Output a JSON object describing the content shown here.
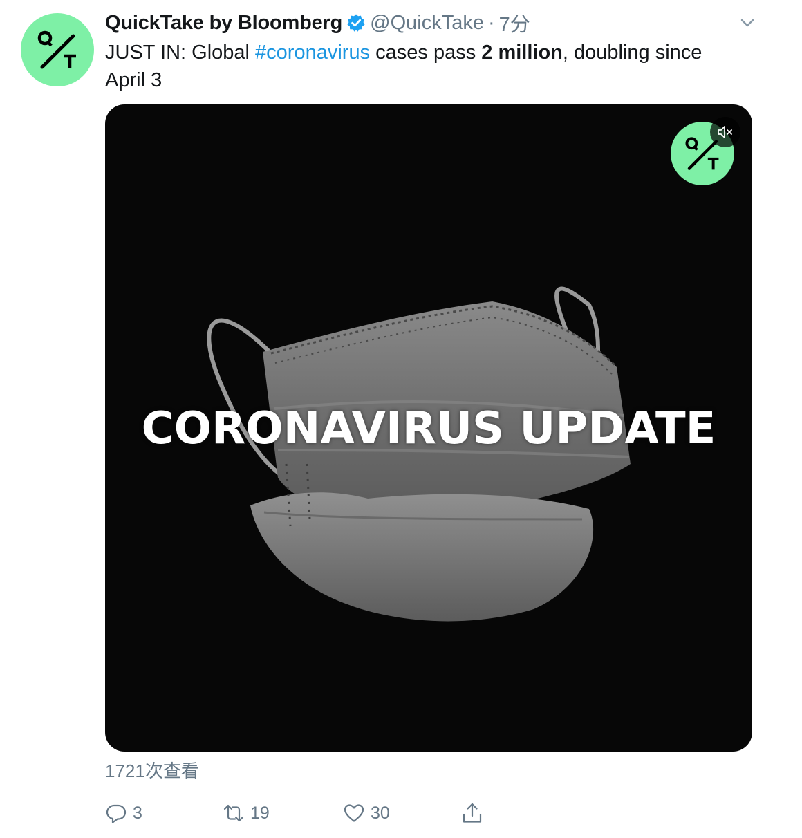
{
  "author": {
    "display_name": "QuickTake by Bloomberg",
    "handle": "@QuickTake",
    "separator": "·",
    "time": "7分",
    "avatar_icon": "quicktake-logo-icon",
    "verified_icon": "verified-badge-icon"
  },
  "tweet": {
    "text_prefix": "JUST IN: Global ",
    "hashtag": "#coronavirus",
    "text_mid": " cases pass ",
    "text_bold": "2 million",
    "text_suffix": ", doubling since April 3"
  },
  "media": {
    "video_title": "CORONAVIRUS UPDATE",
    "overlay_logo_icon": "quicktake-logo-icon",
    "mute_icon": "speaker-muted-icon"
  },
  "views": "1721次查看",
  "actions": {
    "reply_count": "3",
    "retweet_count": "19",
    "like_count": "30",
    "share_icon": "share-icon"
  },
  "colors": {
    "brand_green": "#7ef0a6",
    "link_blue": "#1b95e0",
    "secondary_text": "#657786",
    "media_background": "#070707"
  }
}
